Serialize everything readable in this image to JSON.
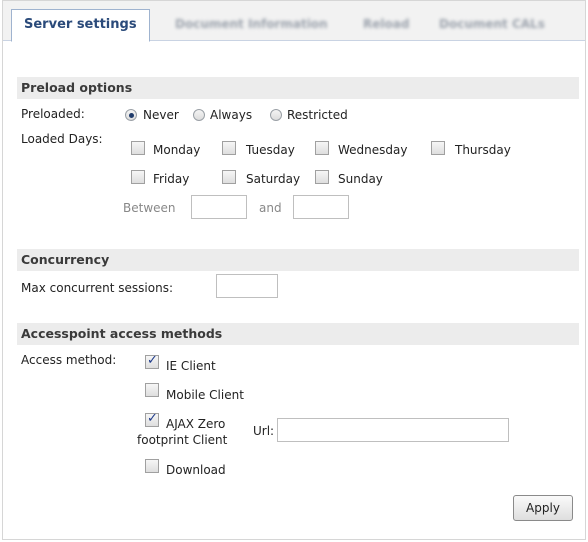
{
  "tabs": [
    {
      "label": "Server settings",
      "active": true
    },
    {
      "label": "Document Information",
      "active": false
    },
    {
      "label": "Reload",
      "active": false
    },
    {
      "label": "Document CALs",
      "active": false
    }
  ],
  "preload": {
    "header": "Preload options",
    "preloaded_label": "Preloaded:",
    "options": [
      "Never",
      "Always",
      "Restricted"
    ],
    "selected": "Never",
    "loaded_days_label": "Loaded Days:",
    "days": [
      "Monday",
      "Tuesday",
      "Wednesday",
      "Thursday",
      "Friday",
      "Saturday",
      "Sunday"
    ],
    "between_label": "Between",
    "and_label": "and",
    "between_from": "",
    "between_to": ""
  },
  "concurrency": {
    "header": "Concurrency",
    "max_sessions_label": "Max concurrent sessions:",
    "max_sessions_value": ""
  },
  "access": {
    "header": "Accesspoint access methods",
    "method_label": "Access method:",
    "ie_client": "IE Client",
    "mobile_client": "Mobile Client",
    "ajax_line1": "AJAX Zero",
    "ajax_line2": "footprint Client",
    "url_label": "Url:",
    "url_value": "",
    "download": "Download"
  },
  "apply_label": "Apply"
}
